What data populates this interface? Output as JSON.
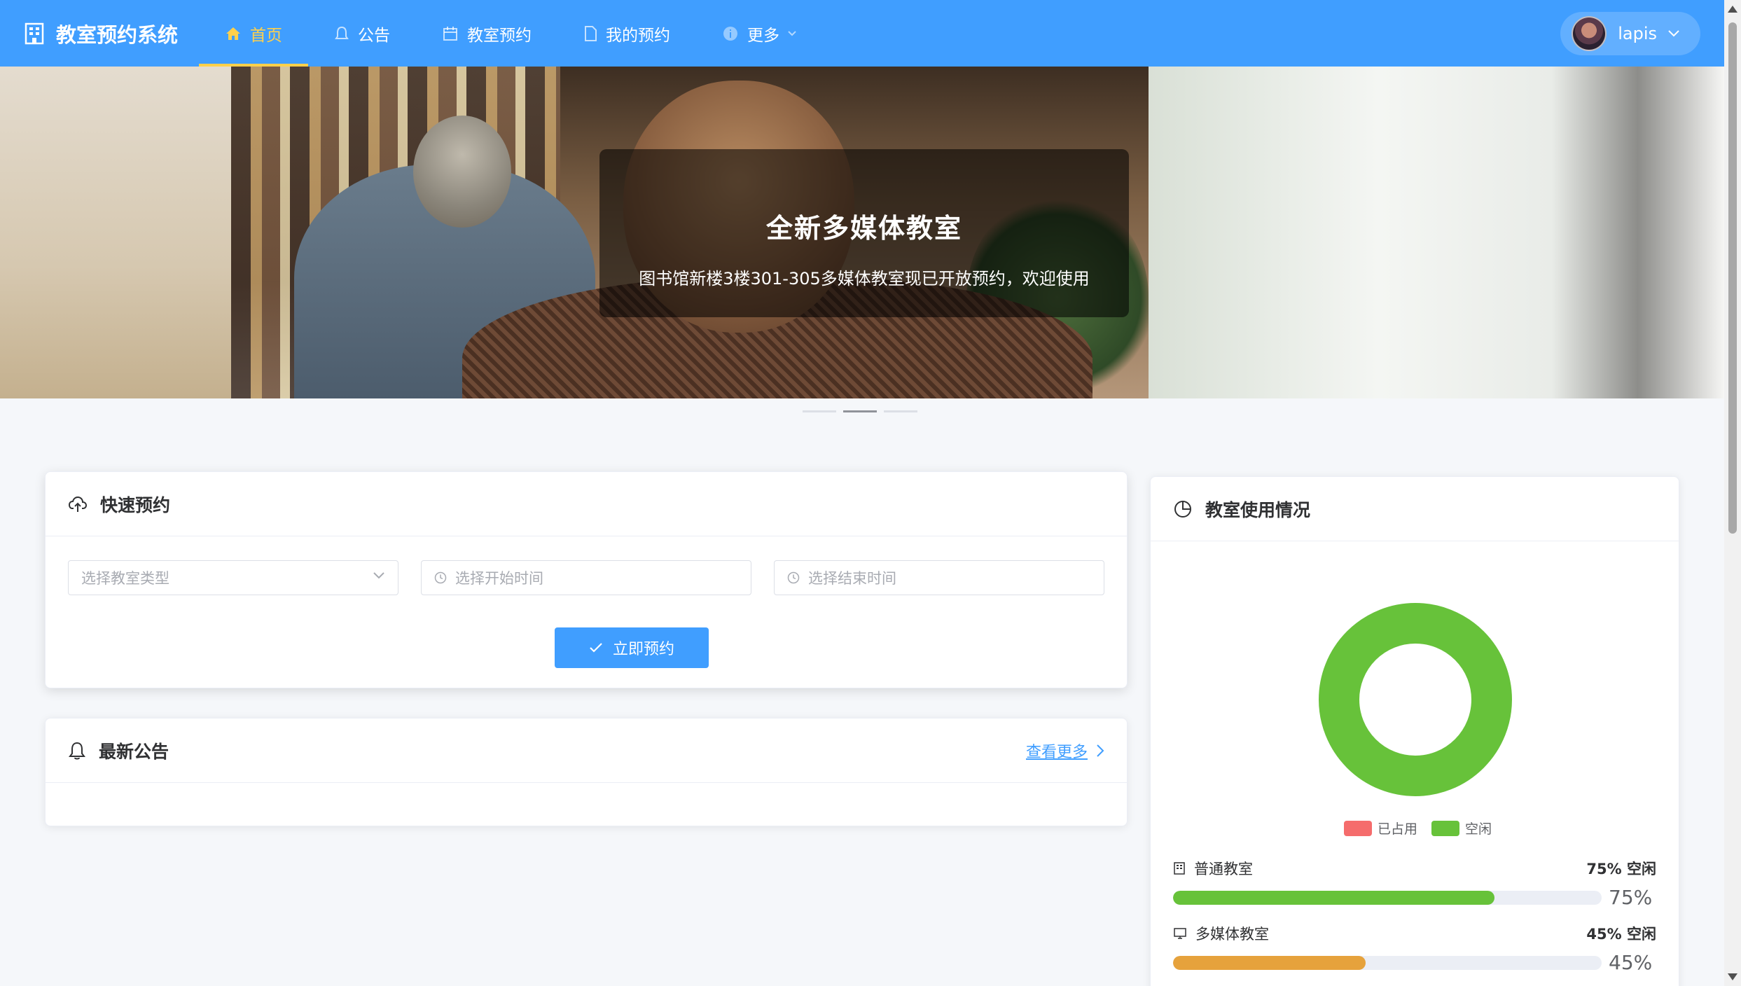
{
  "brand": {
    "title": "教室预约系统",
    "icon": "building-icon"
  },
  "nav": {
    "items": [
      {
        "label": "首页",
        "icon": "home-icon",
        "active": true
      },
      {
        "label": "公告",
        "icon": "bell-icon"
      },
      {
        "label": "教室预约",
        "icon": "calendar-icon"
      },
      {
        "label": "我的预约",
        "icon": "document-icon"
      },
      {
        "label": "更多",
        "icon": "info-icon",
        "has_dropdown": true
      }
    ]
  },
  "user": {
    "name": "lapis"
  },
  "banner": {
    "title": "全新多媒体教室",
    "subtitle": "图书馆新楼3楼301-305多媒体教室现已开放预约，欢迎使用",
    "slides": 3,
    "active_slide": 2
  },
  "quick_booking": {
    "title": "快速预约",
    "room_type_placeholder": "选择教室类型",
    "start_time_placeholder": "选择开始时间",
    "end_time_placeholder": "选择结束时间",
    "submit_label": "立即预约"
  },
  "notices": {
    "title": "最新公告",
    "more_label": "查看更多"
  },
  "usage": {
    "title": "教室使用情况",
    "legend": [
      {
        "label": "已占用",
        "color": "#f56c6c"
      },
      {
        "label": "空闲",
        "color": "#67c23a"
      }
    ],
    "stats": [
      {
        "name": "普通教室",
        "icon": "building-icon",
        "free_text": "75% 空闲",
        "percent": 75,
        "percent_text": "75%",
        "color": "#67c23a"
      },
      {
        "name": "多媒体教室",
        "icon": "monitor-icon",
        "free_text": "45% 空闲",
        "percent": 45,
        "percent_text": "45%",
        "color": "#e6a23c"
      }
    ]
  },
  "chart_data": {
    "type": "pie",
    "categories": [
      "已占用",
      "空闲"
    ],
    "values": [
      0,
      100
    ],
    "colors": [
      "#f56c6c",
      "#67c23a"
    ],
    "legend": "bottom"
  },
  "colors": {
    "primary": "#409eff",
    "active": "#ffd04b",
    "success": "#67c23a",
    "warning": "#e6a23c",
    "danger": "#f56c6c"
  }
}
